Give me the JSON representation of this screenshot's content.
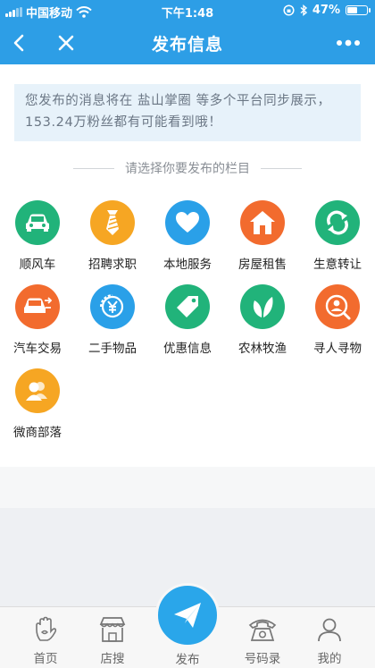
{
  "status_bar": {
    "carrier": "中国移动",
    "time": "下午1:48",
    "battery": "47%",
    "battery_level": 0.47
  },
  "header": {
    "title": "发布信息",
    "back_icon": "chevron-left-icon",
    "close_icon": "close-icon",
    "more_icon": "more-dots-icon"
  },
  "notice": {
    "text": "您发布的消息将在 盐山掌圈 等多个平台同步展示，153.24万粉丝都有可能看到哦！"
  },
  "section": {
    "title": "请选择你要发布的栏目"
  },
  "categories": [
    {
      "label": "顺风车",
      "icon": "car-icon",
      "color": "#21b37a"
    },
    {
      "label": "招聘求职",
      "icon": "tie-icon",
      "color": "#f6a623"
    },
    {
      "label": "本地服务",
      "icon": "heart-icon",
      "color": "#2aa0e8"
    },
    {
      "label": "房屋租售",
      "icon": "house-icon",
      "color": "#f26b2e"
    },
    {
      "label": "生意转让",
      "icon": "transfer-icon",
      "color": "#21b37a"
    },
    {
      "label": "汽车交易",
      "icon": "car-trade-icon",
      "color": "#f26b2e"
    },
    {
      "label": "二手物品",
      "icon": "yuan-coin-icon",
      "color": "#2aa0e8"
    },
    {
      "label": "优惠信息",
      "icon": "tag-icon",
      "color": "#21b37a"
    },
    {
      "label": "农林牧渔",
      "icon": "leaf-icon",
      "color": "#21b37a"
    },
    {
      "label": "寻人寻物",
      "icon": "search-person-icon",
      "color": "#f26b2e"
    },
    {
      "label": "微商部落",
      "icon": "people-icon",
      "color": "#f6a623"
    }
  ],
  "tabbar": {
    "home": "首页",
    "store": "店搜",
    "publish": "发布",
    "phonebook": "号码录",
    "mine": "我的"
  },
  "colors": {
    "brand": "#2d9ee6",
    "publish_button": "#2aa6ea"
  }
}
